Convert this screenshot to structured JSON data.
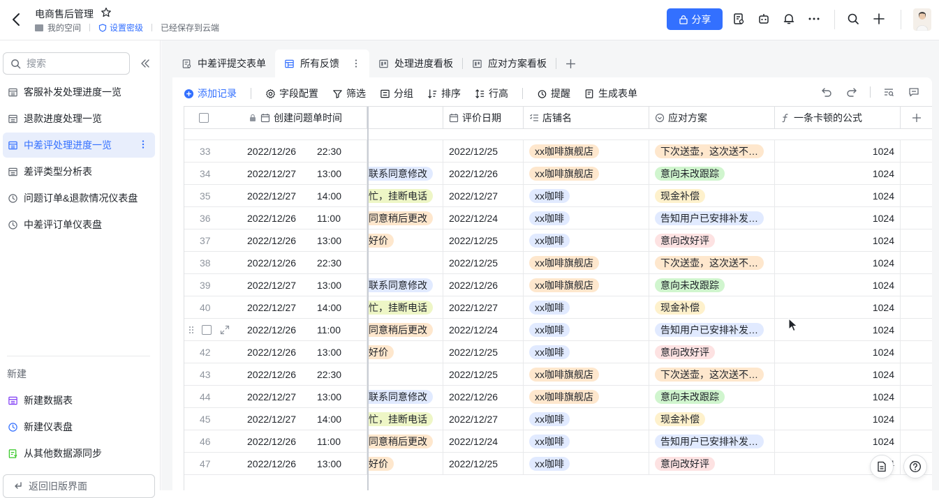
{
  "header": {
    "title": "电商售后管理",
    "breadcrumb_space": "我的空间",
    "security_label": "设置密级",
    "save_status": "已经保存到云端",
    "share_label": "分享"
  },
  "sidebar": {
    "search_placeholder": "搜索",
    "items": [
      {
        "label": "客服补发处理进度一览",
        "icon": "table-icon"
      },
      {
        "label": "退款进度处理一览",
        "icon": "table-icon"
      },
      {
        "label": "中差评处理进度一览",
        "icon": "table-icon",
        "active": true
      },
      {
        "label": "差评类型分析表",
        "icon": "table-icon"
      },
      {
        "label": "问题订单&退款情况仪表盘",
        "icon": "dashboard-icon"
      },
      {
        "label": "中差评订单仪表盘",
        "icon": "dashboard-icon"
      }
    ],
    "new_section": "新建",
    "new_items": [
      {
        "label": "新建数据表",
        "icon": "table-icon",
        "color": "#7f3bf5"
      },
      {
        "label": "新建仪表盘",
        "icon": "dashboard-icon",
        "color": "#3370ff"
      },
      {
        "label": "从其他数据源同步",
        "icon": "sync-icon",
        "color": "#34c724"
      }
    ],
    "old_ui_label": "返回旧版界面"
  },
  "tabs": [
    {
      "label": "中差评提交表单",
      "icon": "form-icon"
    },
    {
      "label": "所有反馈",
      "icon": "grid-icon",
      "active": true
    },
    {
      "label": "处理进度看板",
      "icon": "kanban-icon"
    },
    {
      "label": "应对方案看板",
      "icon": "kanban-icon"
    }
  ],
  "toolbar": {
    "add_record": "添加记录",
    "field_config": "字段配置",
    "filter": "筛选",
    "group": "分组",
    "sort": "排序",
    "row_height": "行高",
    "remind": "提醒",
    "generate_form": "生成表单"
  },
  "columns": {
    "created_time": "创建问题单时间",
    "review_date": "评价日期",
    "shop_name": "店铺名",
    "solution": "应对方案",
    "formula": "一条卡顿的公式"
  },
  "rows": [
    {
      "num": "33",
      "date": "2022/12/26",
      "time": "22:30",
      "progress": "",
      "progress_color": "",
      "review": "2022/12/25",
      "shop": "xx咖啡旗舰店",
      "shop_color": "#fee7cd",
      "plan": "下次送壶，这次送不…",
      "plan_color": "#fee7cd",
      "formula": "1024"
    },
    {
      "num": "34",
      "date": "2022/12/27",
      "time": "13:00",
      "progress": "联系同意修改",
      "progress_color": "#e1eaff",
      "review": "2022/12/26",
      "shop": "xx咖啡旗舰店",
      "shop_color": "#fee7cd",
      "plan": "意向未改跟踪",
      "plan_color": "#d0f5ce",
      "formula": "1024"
    },
    {
      "num": "35",
      "date": "2022/12/27",
      "time": "14:00",
      "progress": "忙，挂断电话",
      "progress_color": "#eef6c6",
      "review": "2022/12/27",
      "shop": "xx咖啡",
      "shop_color": "#e1eaff",
      "plan": "现金补偿",
      "plan_color": "#fef1cc",
      "formula": "1024"
    },
    {
      "num": "36",
      "date": "2022/12/26",
      "time": "11:00",
      "progress": "同意稍后更改",
      "progress_color": "#fee7cd",
      "review": "2022/12/24",
      "shop": "xx咖啡",
      "shop_color": "#e1eaff",
      "plan": "告知用户已安排补发…",
      "plan_color": "#e1eaff",
      "formula": "1024"
    },
    {
      "num": "37",
      "date": "2022/12/26",
      "time": "13:00",
      "progress": "好价",
      "progress_color": "#fee7cd",
      "review": "2022/12/25",
      "shop": "xx咖啡",
      "shop_color": "#e1eaff",
      "plan": "意向改好评",
      "plan_color": "#fde2e2",
      "formula": "1024"
    },
    {
      "num": "38",
      "date": "2022/12/26",
      "time": "22:30",
      "progress": "",
      "progress_color": "",
      "review": "2022/12/25",
      "shop": "xx咖啡旗舰店",
      "shop_color": "#fee7cd",
      "plan": "下次送壶，这次送不…",
      "plan_color": "#fee7cd",
      "formula": "1024"
    },
    {
      "num": "39",
      "date": "2022/12/27",
      "time": "13:00",
      "progress": "联系同意修改",
      "progress_color": "#e1eaff",
      "review": "2022/12/26",
      "shop": "xx咖啡旗舰店",
      "shop_color": "#fee7cd",
      "plan": "意向未改跟踪",
      "plan_color": "#d0f5ce",
      "formula": "1024"
    },
    {
      "num": "40",
      "date": "2022/12/27",
      "time": "14:00",
      "progress": "忙，挂断电话",
      "progress_color": "#eef6c6",
      "review": "2022/12/27",
      "shop": "xx咖啡",
      "shop_color": "#e1eaff",
      "plan": "现金补偿",
      "plan_color": "#fef1cc",
      "formula": "1024"
    },
    {
      "num": "",
      "date": "2022/12/26",
      "time": "11:00",
      "progress": "同意稍后更改",
      "progress_color": "#fee7cd",
      "review": "2022/12/24",
      "shop": "xx咖啡",
      "shop_color": "#e1eaff",
      "plan": "告知用户已安排补发…",
      "plan_color": "#e1eaff",
      "formula": "1024",
      "hover": true
    },
    {
      "num": "42",
      "date": "2022/12/26",
      "time": "13:00",
      "progress": "好价",
      "progress_color": "#fee7cd",
      "review": "2022/12/25",
      "shop": "xx咖啡",
      "shop_color": "#e1eaff",
      "plan": "意向改好评",
      "plan_color": "#fde2e2",
      "formula": "1024"
    },
    {
      "num": "43",
      "date": "2022/12/26",
      "time": "22:30",
      "progress": "",
      "progress_color": "",
      "review": "2022/12/25",
      "shop": "xx咖啡旗舰店",
      "shop_color": "#fee7cd",
      "plan": "下次送壶，这次送不…",
      "plan_color": "#fee7cd",
      "formula": "1024"
    },
    {
      "num": "44",
      "date": "2022/12/27",
      "time": "13:00",
      "progress": "联系同意修改",
      "progress_color": "#e1eaff",
      "review": "2022/12/26",
      "shop": "xx咖啡旗舰店",
      "shop_color": "#fee7cd",
      "plan": "意向未改跟踪",
      "plan_color": "#d0f5ce",
      "formula": "1024"
    },
    {
      "num": "45",
      "date": "2022/12/27",
      "time": "14:00",
      "progress": "忙，挂断电话",
      "progress_color": "#eef6c6",
      "review": "2022/12/27",
      "shop": "xx咖啡",
      "shop_color": "#e1eaff",
      "plan": "现金补偿",
      "plan_color": "#fef1cc",
      "formula": "1024"
    },
    {
      "num": "46",
      "date": "2022/12/26",
      "time": "11:00",
      "progress": "同意稍后更改",
      "progress_color": "#fee7cd",
      "review": "2022/12/24",
      "shop": "xx咖啡",
      "shop_color": "#e1eaff",
      "plan": "告知用户已安排补发…",
      "plan_color": "#e1eaff",
      "formula": "1024"
    },
    {
      "num": "47",
      "date": "2022/12/26",
      "time": "13:00",
      "progress": "好价",
      "progress_color": "#fee7cd",
      "review": "2022/12/25",
      "shop": "xx咖啡",
      "shop_color": "#e1eaff",
      "plan": "意向改好评",
      "plan_color": "#fde2e2",
      "formula": "1024"
    }
  ],
  "colors": {
    "accent": "#3370ff",
    "active_bg": "#e8eefc"
  }
}
